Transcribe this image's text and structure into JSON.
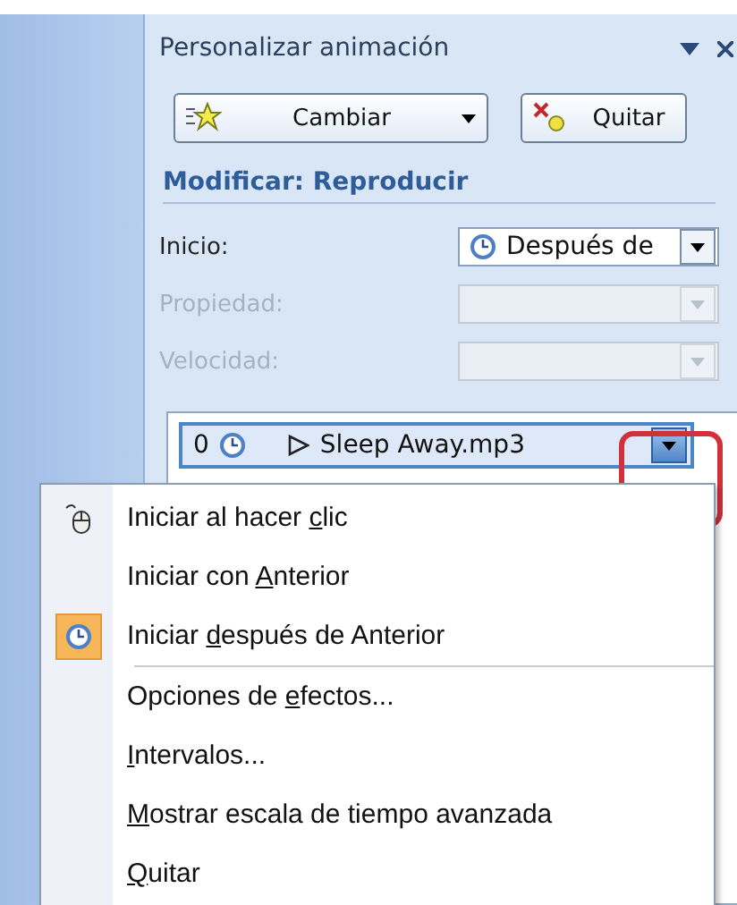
{
  "panel": {
    "title": "Personalizar animación",
    "buttons": [
      {
        "label": "Cambiar",
        "kind": "change"
      },
      {
        "label": "Quitar",
        "kind": "remove"
      }
    ],
    "section": "Modificar: Reproducir",
    "fields": [
      {
        "label": "Inicio:",
        "value": "Después de",
        "disabled": false
      },
      {
        "label": "Propiedad:",
        "disabled": true
      },
      {
        "label": "Velocidad:",
        "disabled": true
      }
    ],
    "list": [
      {
        "order": "0",
        "name": "Sleep Away.mp3",
        "selected": true
      }
    ]
  },
  "menu": [
    {
      "kind": "click",
      "before": "Iniciar al hacer ",
      "key": "c",
      "after": "lic",
      "checked": false
    },
    {
      "kind": "with-previous",
      "before": "Iniciar con ",
      "key": "A",
      "after": "nterior",
      "checked": false
    },
    {
      "kind": "after-previous",
      "before": "Iniciar ",
      "key": "d",
      "after": "espués de Anterior",
      "checked": true
    },
    {
      "kind": "command",
      "before": "Opciones de ",
      "key": "e",
      "after": "fectos...",
      "checked": false
    },
    {
      "kind": "command",
      "key": "I",
      "after": "ntervalos...",
      "checked": false
    },
    {
      "kind": "command",
      "key": "M",
      "after": "ostrar escala de tiempo avanzada",
      "checked": false
    },
    {
      "kind": "command",
      "key": "Q",
      "after": "uitar",
      "checked": false
    }
  ]
}
